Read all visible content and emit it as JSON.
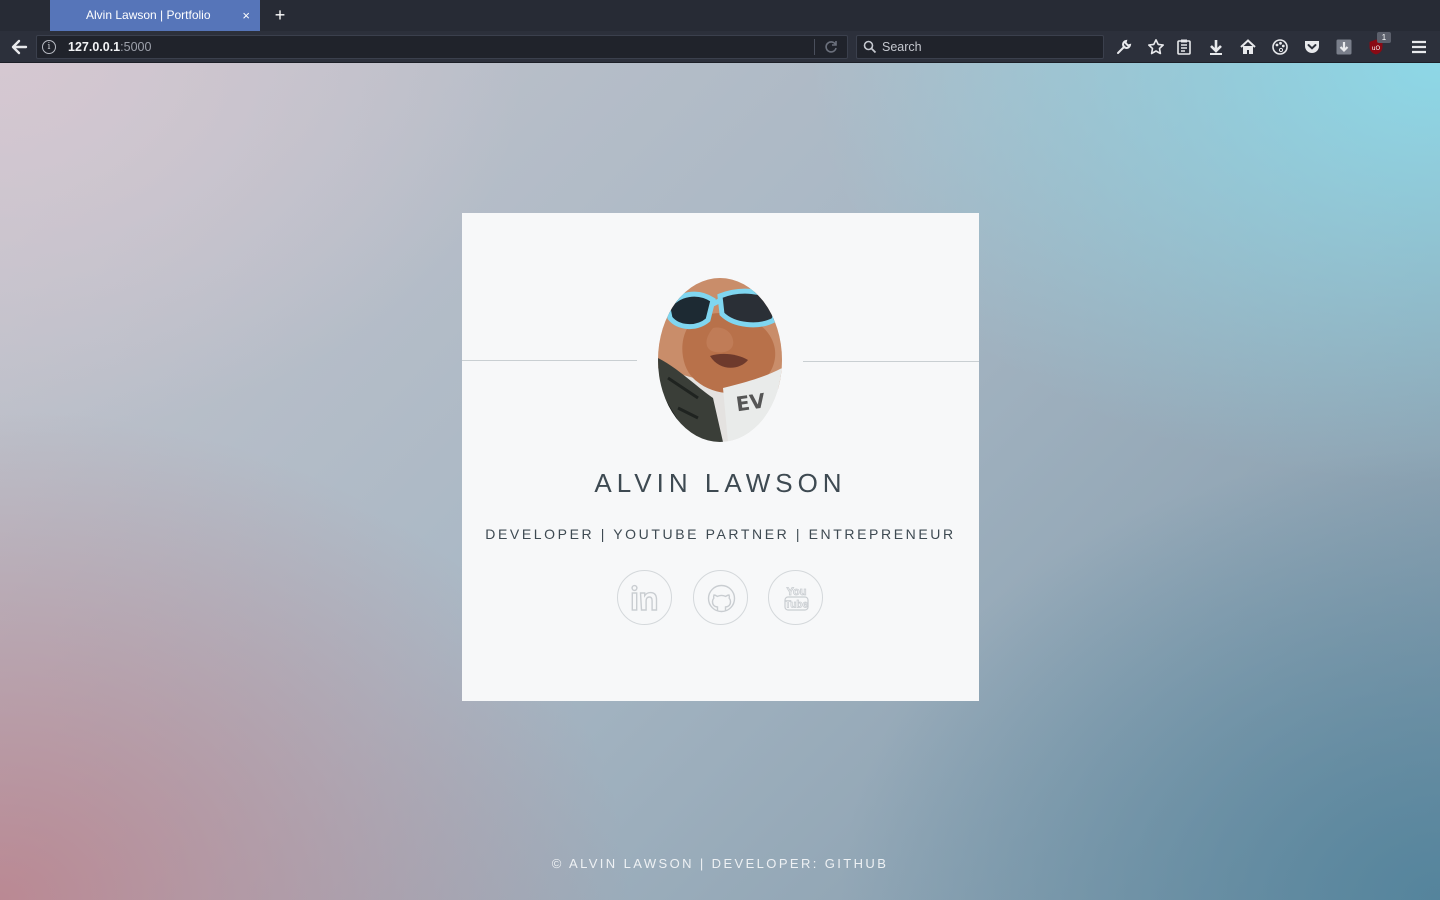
{
  "browser": {
    "tab": {
      "title": "Alvin Lawson | Portfolio",
      "close": "×"
    },
    "new_tab": "+",
    "url": {
      "host": "127.0.0.1",
      "port": ":5000"
    },
    "search_placeholder": "Search",
    "toolbar_icons": [
      "wrench-icon",
      "bookmark-star-icon",
      "reading-list-icon",
      "download-icon",
      "home-icon",
      "palette-icon",
      "pocket-icon",
      "download-manager-icon",
      "ublock-icon",
      "hamburger-menu-icon"
    ],
    "ublock_badge": "1"
  },
  "profile": {
    "name": "ALVIN LAWSON",
    "tagline": "DEVELOPER | YOUTUBE PARTNER | ENTREPRENEUR",
    "social": [
      "linkedin-icon",
      "github-icon",
      "youtube-icon"
    ]
  },
  "footer": {
    "text": "© ALVIN LAWSON | DEVELOPER: GITHUB"
  },
  "colors": {
    "tab_active": "#5675b9",
    "chrome_bg": "#272b35",
    "card_bg": "#f7f8f9",
    "text_dark": "#3e4a52"
  }
}
